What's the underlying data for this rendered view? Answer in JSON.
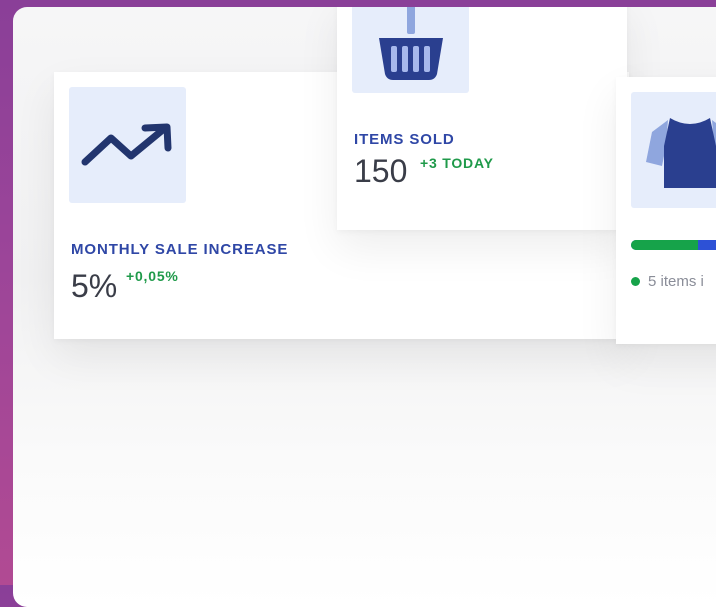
{
  "cards": [
    {
      "id": "monthly-sale",
      "icon": "trending-up-icon",
      "title": "MONTHLY SALE INCREASE",
      "value": "5%",
      "delta": "+0,05%"
    },
    {
      "id": "items-sold",
      "icon": "shopping-basket-icon",
      "title": "ITEMS SOLD",
      "value": "150",
      "delta": "+3 TODAY"
    },
    {
      "id": "clothing-stock",
      "icon": "shirt-icon",
      "progress_fraction": 0.35,
      "status_text": "5 items i"
    }
  ],
  "colors": {
    "accent_blue": "#2f47a6",
    "positive_green": "#1f9a4a",
    "icon_bg": "#e6edfb",
    "background_gradient_start": "#8a3f98",
    "background_gradient_end": "#b14a93"
  }
}
